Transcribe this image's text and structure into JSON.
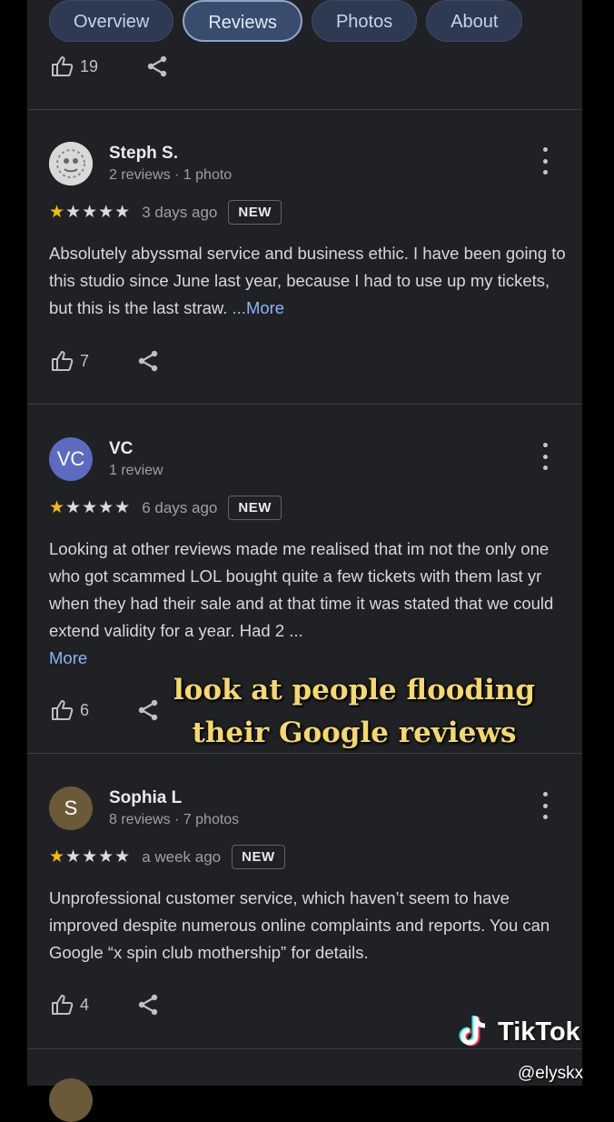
{
  "tabs": [
    {
      "label": "Overview",
      "active": false
    },
    {
      "label": "Reviews",
      "active": true
    },
    {
      "label": "Photos",
      "active": false
    },
    {
      "label": "About",
      "active": false
    }
  ],
  "top_likes": "19",
  "reviews": [
    {
      "name": "Steph S.",
      "meta": "2 reviews · 1 photo",
      "avatar_initials": "",
      "rating": 1,
      "time": "3 days ago",
      "badge": "NEW",
      "text": "Absolutely abyssmal service and business ethic. I have been going to this studio since June last year, because I had to use up my tickets, but this is the last straw. ",
      "more": "...More",
      "likes": "7"
    },
    {
      "name": "VC",
      "meta": "1 review",
      "avatar_initials": "VC",
      "rating": 1,
      "time": "6 days ago",
      "badge": "NEW",
      "text": "Looking at other reviews made me realised that im not the only one who got scammed LOL bought quite a few tickets with them last yr when they had their sale and at that time it was stated that we could extend validity for a year. Had 2 ...",
      "more": "More",
      "likes": "6"
    },
    {
      "name": "Sophia L",
      "meta": "8 reviews · 7 photos",
      "avatar_initials": "S",
      "rating": 1,
      "time": "a week ago",
      "badge": "NEW",
      "text": "Unprofessional customer service, which haven’t seem to have improved despite numerous online complaints and reports. You can Google “x spin club mothership” for details.",
      "more": "",
      "likes": "4"
    }
  ],
  "overlay": {
    "line1": "look at people flooding",
    "line2": "their Google reviews"
  },
  "watermark": {
    "brand": "TikTok",
    "handle": "@elyskx"
  },
  "colors": {
    "star": "#fbbc04",
    "link": "#8ab4f8",
    "vc_avatar": "#5c6bc0",
    "s_avatar": "#6b5a3a"
  },
  "icons": [
    "thumb-up-icon",
    "share-icon",
    "more-vert-icon",
    "star-icon",
    "tiktok-logo-icon"
  ]
}
